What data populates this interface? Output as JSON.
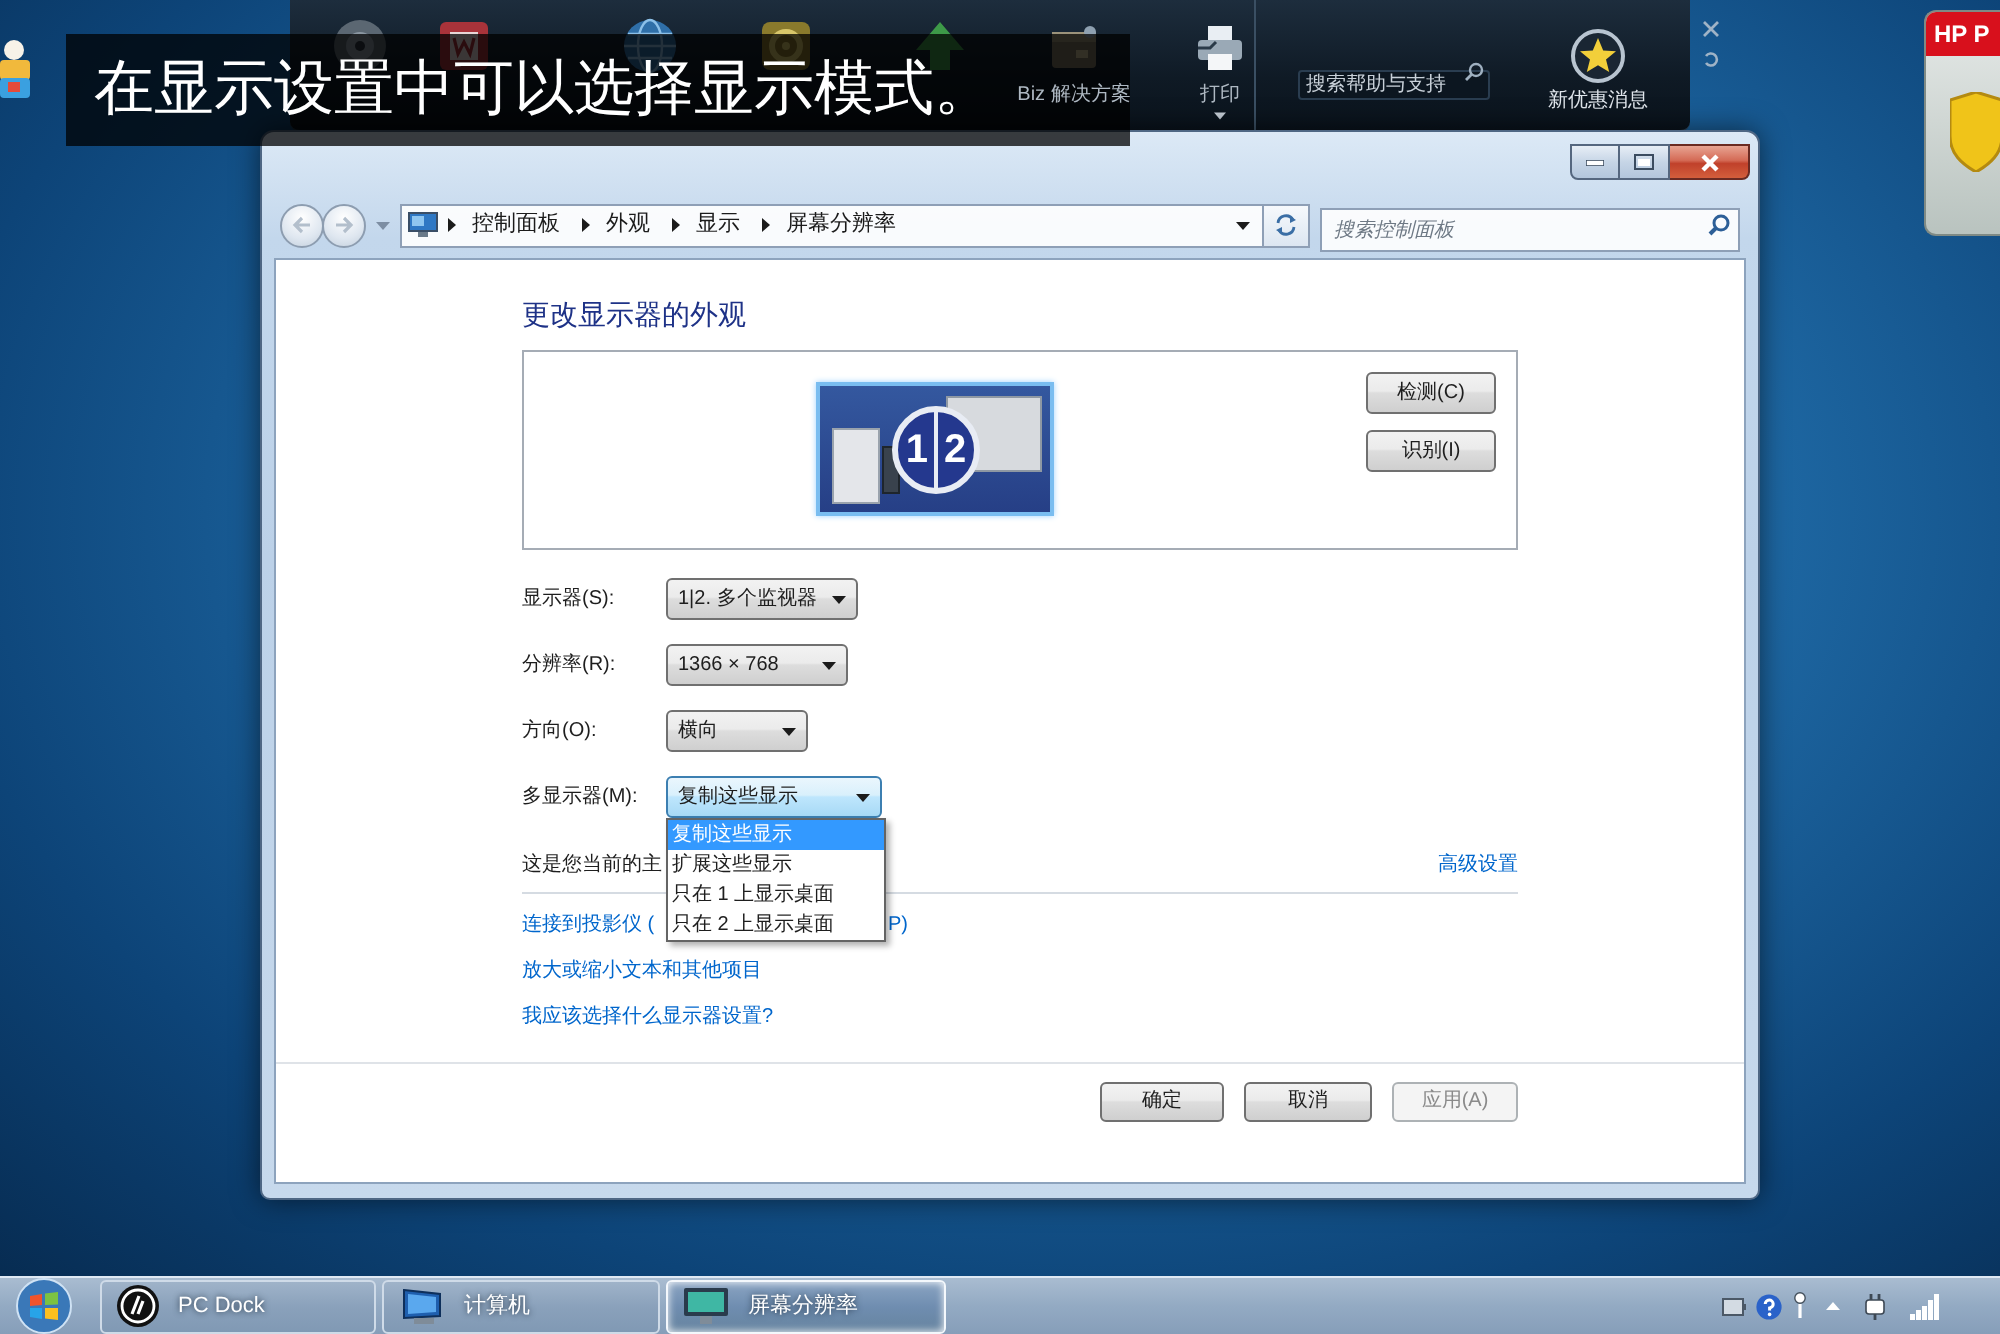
{
  "caption": "在显示设置中可以选择显示模式。",
  "dock": {
    "apps": [
      {
        "label": "Biz 解决方案"
      },
      {
        "label": "打印"
      }
    ],
    "search": {
      "placeholder": "搜索帮助与支持"
    },
    "promo": {
      "label": "新优惠消息"
    }
  },
  "hp_widget": {
    "title": "HP P"
  },
  "window": {
    "breadcrumbs": [
      "控制面板",
      "外观",
      "显示",
      "屏幕分辨率"
    ],
    "search": {
      "placeholder": "搜索控制面板"
    },
    "heading": "更改显示器的外观",
    "preview": {
      "display_numbers": [
        "1",
        "2"
      ],
      "buttons": [
        "检测(C)",
        "识别(I)"
      ]
    },
    "fields": [
      {
        "label": "显示器(S):",
        "value": "1|2. 多个监视器",
        "focused": false
      },
      {
        "label": "分辨率(R):",
        "value": "1366 × 768",
        "focused": false
      },
      {
        "label": "方向(O):",
        "value": "横向",
        "focused": false
      },
      {
        "label": "多显示器(M):",
        "value": "复制这些显示",
        "focused": true,
        "options": [
          {
            "label": "复制这些显示",
            "selected": true
          },
          {
            "label": "扩展这些显示",
            "selected": false
          },
          {
            "label": "只在 1 上显示桌面",
            "selected": false
          },
          {
            "label": "只在 2 上显示桌面",
            "selected": false
          }
        ]
      }
    ],
    "primary_note": "这是您当前的主",
    "advanced_link": "高级设置",
    "links": [
      {
        "text": "连接到投影仪 (",
        "tail": "P)"
      },
      {
        "text": "放大或缩小文本和其他项目"
      },
      {
        "text": "我应该选择什么显示器设置?"
      }
    ],
    "buttons": [
      {
        "label": "确定",
        "disabled": false
      },
      {
        "label": "取消",
        "disabled": false
      },
      {
        "label": "应用(A)",
        "disabled": true
      }
    ]
  },
  "taskbar": {
    "buttons": [
      {
        "label": "PC Dock",
        "selected": false
      },
      {
        "label": "计算机",
        "selected": false
      },
      {
        "label": "屏幕分辨率",
        "selected": true
      }
    ]
  }
}
